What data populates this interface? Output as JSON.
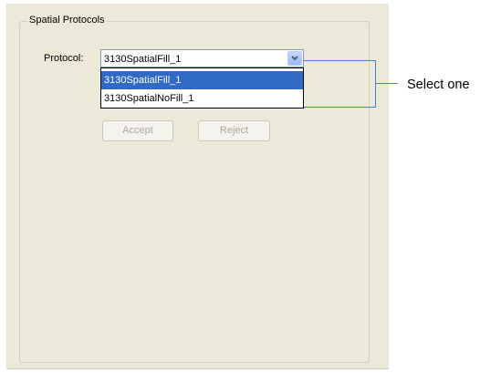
{
  "group": {
    "title": "Spatial Protocols"
  },
  "protocol": {
    "label": "Protocol:",
    "selected_value": "3130SpatialFill_1",
    "options": [
      "3130SpatialFill_1",
      "3130SpatialNoFill_1"
    ],
    "dropdown_icon": "chevron-down-icon"
  },
  "buttons": {
    "accept": "Accept",
    "reject": "Reject"
  },
  "callout": {
    "text": "Select one"
  },
  "colors": {
    "panel_bg": "#ece9d8",
    "selection_bg": "#316ac5",
    "callout_line": "#4a81c9",
    "disabled_text": "#aca899"
  }
}
